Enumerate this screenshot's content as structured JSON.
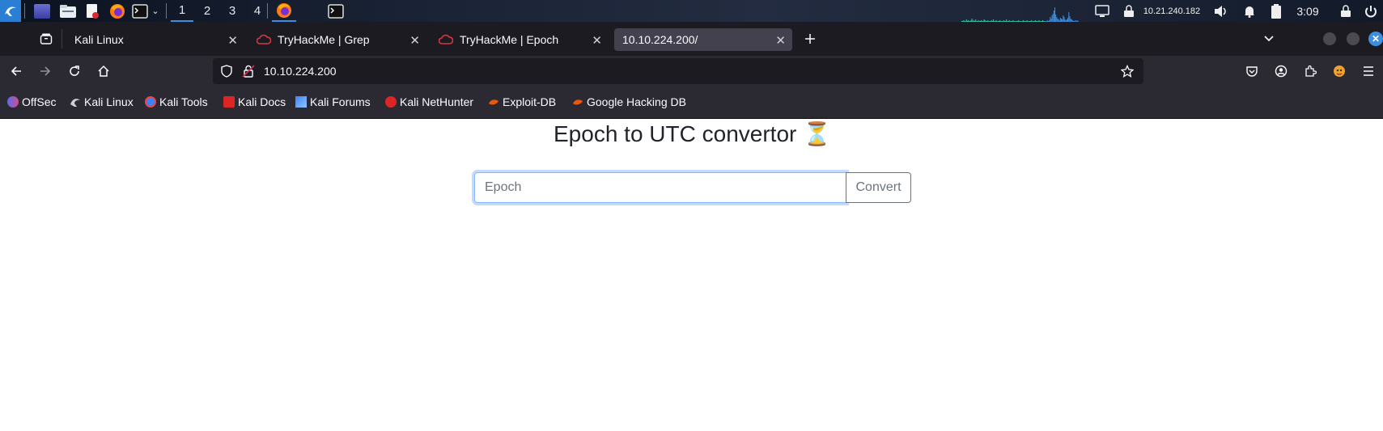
{
  "panel": {
    "workspaces": [
      "1",
      "2",
      "3",
      "4"
    ],
    "active_workspace": "1",
    "ip_address": "10.21.240.182",
    "clock": "3:09",
    "icons": [
      "kali-menu-icon",
      "desktop-icon",
      "file-manager-icon",
      "text-editor-icon",
      "firefox-icon",
      "terminal-icon",
      "firefox-window-icon",
      "terminal-window-icon",
      "display-icon",
      "vpn-lock-icon",
      "volume-icon",
      "notification-bell-icon",
      "battery-icon",
      "lock-screen-icon",
      "power-icon"
    ]
  },
  "tabs": [
    {
      "label": "Kali Linux",
      "favicon": "none",
      "selected": false
    },
    {
      "label": "TryHackMe | Grep",
      "favicon": "tryhackme-cloud-icon",
      "selected": false
    },
    {
      "label": "TryHackMe | Epoch",
      "favicon": "tryhackme-cloud-icon",
      "selected": false
    },
    {
      "label": "10.10.224.200/",
      "favicon": "none",
      "selected": true
    }
  ],
  "navbar": {
    "url": "10.10.224.200"
  },
  "bookmarks": [
    {
      "label": "OffSec",
      "icon": "offsec-icon",
      "color": "#5b6cf0"
    },
    {
      "label": "Kali Linux",
      "icon": "kali-dragon-icon",
      "color": "#cccccc"
    },
    {
      "label": "Kali Tools",
      "icon": "kali-tools-icon",
      "color": "#3b82f6"
    },
    {
      "label": "Kali Docs",
      "icon": "kali-docs-icon",
      "color": "#dc2626"
    },
    {
      "label": "Kali Forums",
      "icon": "kali-forums-icon",
      "color": "#3b82f6"
    },
    {
      "label": "Kali NetHunter",
      "icon": "kali-nethunter-icon",
      "color": "#dc2626"
    },
    {
      "label": "Exploit-DB",
      "icon": "exploit-db-icon",
      "color": "#ea580c"
    },
    {
      "label": "Google Hacking DB",
      "icon": "ghdb-icon",
      "color": "#ea580c"
    }
  ],
  "page": {
    "title": "Epoch to UTC convertor ⏳",
    "input_placeholder": "Epoch",
    "input_value": "",
    "button_label": "Convert"
  },
  "colors": {
    "tab_strip": "#1c1b22",
    "toolbar": "#2b2a33",
    "focus_ring": "#86b7fe",
    "button_border": "#6c757d"
  }
}
